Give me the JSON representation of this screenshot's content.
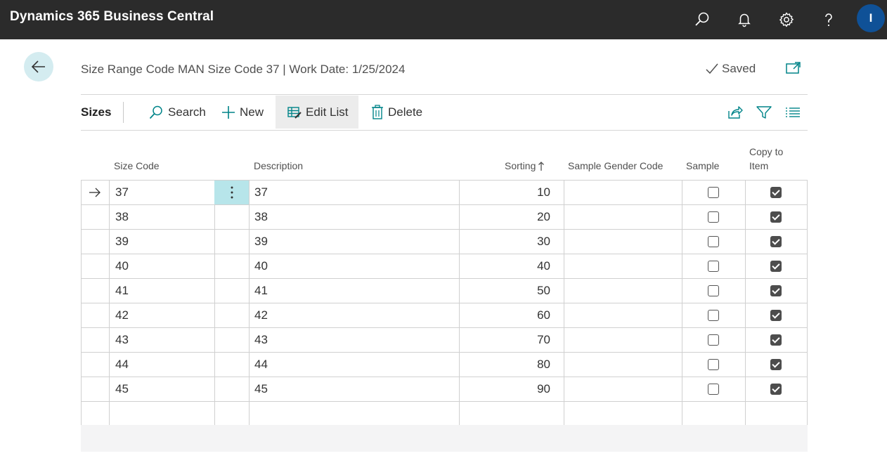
{
  "app": {
    "title": "Dynamics 365 Business Central",
    "avatar_initial": "I"
  },
  "topbar_icons": [
    "search-icon",
    "bell-icon",
    "gear-icon",
    "help-icon"
  ],
  "page": {
    "caption": "Size Range Code MAN Size Code 37 | Work Date: 1/25/2024",
    "saved_label": "Saved"
  },
  "actionbar": {
    "title": "Sizes",
    "search_label": "Search",
    "new_label": "New",
    "edit_list_label": "Edit List",
    "delete_label": "Delete"
  },
  "grid": {
    "headers": {
      "size_code": "Size Code",
      "description": "Description",
      "sorting": "Sorting",
      "sample_gender_code": "Sample Gender Code",
      "sample": "Sample",
      "copy_to_item_1": "Copy to",
      "copy_to_item_2": "Item"
    },
    "selected_row": 0,
    "rows": [
      {
        "size_code": "37",
        "description": "37",
        "sorting": "10",
        "sample_gender_code": "",
        "sample": false,
        "copy_to_item": true
      },
      {
        "size_code": "38",
        "description": "38",
        "sorting": "20",
        "sample_gender_code": "",
        "sample": false,
        "copy_to_item": true
      },
      {
        "size_code": "39",
        "description": "39",
        "sorting": "30",
        "sample_gender_code": "",
        "sample": false,
        "copy_to_item": true
      },
      {
        "size_code": "40",
        "description": "40",
        "sorting": "40",
        "sample_gender_code": "",
        "sample": false,
        "copy_to_item": true
      },
      {
        "size_code": "41",
        "description": "41",
        "sorting": "50",
        "sample_gender_code": "",
        "sample": false,
        "copy_to_item": true
      },
      {
        "size_code": "42",
        "description": "42",
        "sorting": "60",
        "sample_gender_code": "",
        "sample": false,
        "copy_to_item": true
      },
      {
        "size_code": "43",
        "description": "43",
        "sorting": "70",
        "sample_gender_code": "",
        "sample": false,
        "copy_to_item": true
      },
      {
        "size_code": "44",
        "description": "44",
        "sorting": "80",
        "sample_gender_code": "",
        "sample": false,
        "copy_to_item": true
      },
      {
        "size_code": "45",
        "description": "45",
        "sorting": "90",
        "sample_gender_code": "",
        "sample": false,
        "copy_to_item": true
      }
    ]
  },
  "colors": {
    "topbar": "#2b2b2b",
    "accent": "#0f5197",
    "teal": "#008489",
    "selection": "#b7e5ea"
  }
}
